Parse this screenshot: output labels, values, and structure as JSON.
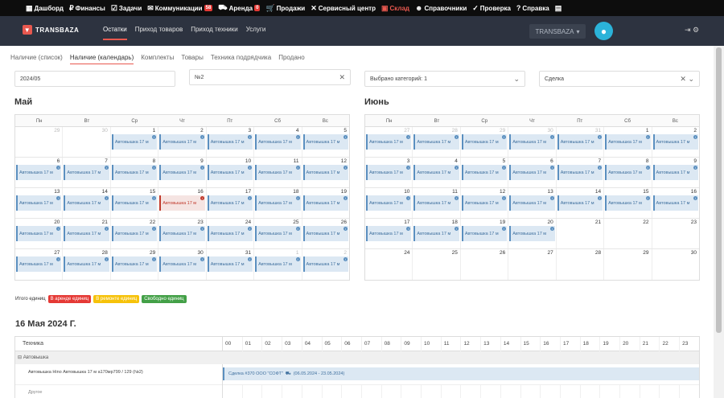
{
  "topnav": [
    {
      "icon": "▦",
      "label": "Дашборд",
      "name": "dashboard"
    },
    {
      "icon": "₽",
      "label": "Финансы",
      "name": "finance"
    },
    {
      "icon": "☑",
      "label": "Задачи",
      "name": "tasks"
    },
    {
      "icon": "✉",
      "label": "Коммуникации",
      "name": "communications",
      "badge": "58"
    },
    {
      "icon": "⛟",
      "label": "Аренда",
      "name": "rent",
      "badge": "0"
    },
    {
      "icon": "🛒",
      "label": "Продажи",
      "name": "sales"
    },
    {
      "icon": "✕",
      "label": "Сервисный центр",
      "name": "service"
    },
    {
      "icon": "▣",
      "label": "Склад",
      "name": "warehouse",
      "active": true
    },
    {
      "icon": "☻",
      "label": "Справочники",
      "name": "directories"
    },
    {
      "icon": "✓",
      "label": "Проверка",
      "name": "check"
    },
    {
      "icon": "?",
      "label": "Справка",
      "name": "help"
    },
    {
      "icon": "▤",
      "label": "",
      "name": "chat"
    }
  ],
  "header": {
    "logo": "TRANSBAZA",
    "tabs": [
      "Остатки",
      "Приход товаров",
      "Приход техники",
      "Услуги"
    ],
    "active_tab": 0,
    "company": "TRANSBAZA",
    "colors": {
      "accent": "#e8584f",
      "header_bg": "#2d3340"
    }
  },
  "subtabs": [
    "Наличие (список)",
    "Наличие (календарь)",
    "Комплекты",
    "Товары",
    "Техника подрядчика",
    "Продано"
  ],
  "active_subtab": 1,
  "filters": {
    "month": "2024/05",
    "number": "№2",
    "category": "Выбрано категорий: 1",
    "deal": "Сделка"
  },
  "weekdays": [
    "Пн",
    "Вт",
    "Ср",
    "Чт",
    "Пт",
    "Сб",
    "Вс"
  ],
  "calendars": [
    {
      "title": "Май",
      "weeks": [
        [
          {
            "d": "29",
            "o": 1
          },
          {
            "d": "30",
            "o": 1
          },
          {
            "d": "1",
            "e": 1
          },
          {
            "d": "2",
            "e": 1
          },
          {
            "d": "3",
            "e": 1
          },
          {
            "d": "4",
            "e": 1
          },
          {
            "d": "5",
            "e": 1
          }
        ],
        [
          {
            "d": "6",
            "e": 1
          },
          {
            "d": "7",
            "e": 1
          },
          {
            "d": "8",
            "e": 1
          },
          {
            "d": "9",
            "e": 1
          },
          {
            "d": "10",
            "e": 1
          },
          {
            "d": "11",
            "e": 1
          },
          {
            "d": "12",
            "e": 1
          }
        ],
        [
          {
            "d": "13",
            "e": 1
          },
          {
            "d": "14",
            "e": 1
          },
          {
            "d": "15",
            "e": 1
          },
          {
            "d": "16",
            "e": 1,
            "t": 1
          },
          {
            "d": "17",
            "e": 1
          },
          {
            "d": "18",
            "e": 1
          },
          {
            "d": "19",
            "e": 1
          }
        ],
        [
          {
            "d": "20",
            "e": 1
          },
          {
            "d": "21",
            "e": 1
          },
          {
            "d": "22",
            "e": 1
          },
          {
            "d": "23",
            "e": 1
          },
          {
            "d": "24",
            "e": 1
          },
          {
            "d": "25",
            "e": 1
          },
          {
            "d": "26",
            "e": 1
          }
        ],
        [
          {
            "d": "27",
            "e": 1
          },
          {
            "d": "28",
            "e": 1
          },
          {
            "d": "29",
            "e": 1
          },
          {
            "d": "30",
            "e": 1
          },
          {
            "d": "31",
            "e": 1
          },
          {
            "d": "1",
            "o": 1,
            "e": 1
          },
          {
            "d": "2",
            "o": 1,
            "e": 1
          }
        ]
      ]
    },
    {
      "title": "Июнь",
      "weeks": [
        [
          {
            "d": "27",
            "o": 1,
            "e": 1
          },
          {
            "d": "28",
            "o": 1,
            "e": 1
          },
          {
            "d": "29",
            "o": 1,
            "e": 1
          },
          {
            "d": "30",
            "o": 1,
            "e": 1
          },
          {
            "d": "31",
            "o": 1,
            "e": 1
          },
          {
            "d": "1",
            "e": 1
          },
          {
            "d": "2",
            "e": 1
          }
        ],
        [
          {
            "d": "3",
            "e": 1
          },
          {
            "d": "4",
            "e": 1
          },
          {
            "d": "5",
            "e": 1
          },
          {
            "d": "6",
            "e": 1
          },
          {
            "d": "7",
            "e": 1
          },
          {
            "d": "8",
            "e": 1
          },
          {
            "d": "9",
            "e": 1
          }
        ],
        [
          {
            "d": "10",
            "e": 1
          },
          {
            "d": "11",
            "e": 1
          },
          {
            "d": "12",
            "e": 1
          },
          {
            "d": "13",
            "e": 1
          },
          {
            "d": "14",
            "e": 1
          },
          {
            "d": "15",
            "e": 1
          },
          {
            "d": "16",
            "e": 1
          }
        ],
        [
          {
            "d": "17",
            "e": 1
          },
          {
            "d": "18",
            "e": 1
          },
          {
            "d": "19",
            "e": 1
          },
          {
            "d": "20",
            "e": 1
          },
          {
            "d": "21"
          },
          {
            "d": "22"
          },
          {
            "d": "23"
          }
        ],
        [
          {
            "d": "24"
          },
          {
            "d": "25"
          },
          {
            "d": "26"
          },
          {
            "d": "27"
          },
          {
            "d": "28"
          },
          {
            "d": "29"
          },
          {
            "d": "30"
          }
        ]
      ]
    }
  ],
  "event_label": "Автовышка 17 м",
  "legend": {
    "total": "Итого единиц",
    "rented": {
      "label": "В аренде единиц",
      "color": "#e53935"
    },
    "repair": {
      "label": "В ремонте единиц",
      "color": "#f6c20a"
    },
    "free": {
      "label": "Свободно единиц",
      "color": "#43a047"
    }
  },
  "day_title": "16 Мая 2024 Г.",
  "timeline": {
    "col_header": "Техника",
    "hours": [
      "00",
      "01",
      "02",
      "03",
      "04",
      "05",
      "06",
      "07",
      "08",
      "09",
      "10",
      "11",
      "12",
      "13",
      "14",
      "15",
      "16",
      "17",
      "18",
      "19",
      "20",
      "21",
      "22",
      "23"
    ],
    "group": "Автовышка",
    "row_label": "Автовышка Hino Автовышка 17 м а170мр799 / 129 (№2)",
    "bar_label": "Сделка #370 ООО \"СОФТ\"",
    "bar_dates": "(06.05.2024 - 23.05.2024)",
    "next_group": "Другое"
  }
}
